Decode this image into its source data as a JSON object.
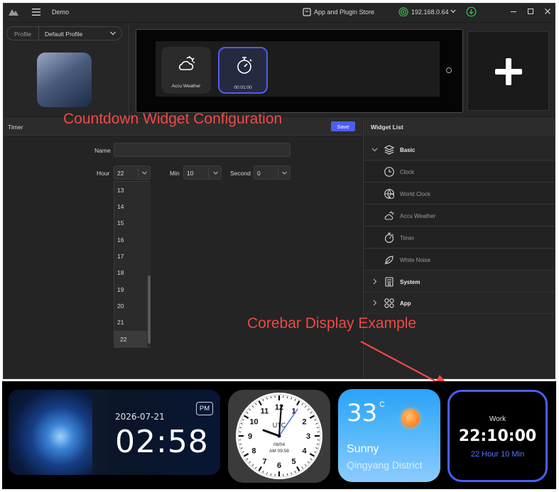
{
  "titlebar": {
    "title": "Demo",
    "store_label": "App and Plugin Store",
    "ip": "192.168.0.64"
  },
  "profile": {
    "label": "Profile",
    "selected": "Default Profile"
  },
  "preview": {
    "widgets": [
      {
        "label": "Accu Weather",
        "icon": "weather-cloud-sun-icon"
      },
      {
        "label": "00:01:00",
        "icon": "timer-icon"
      }
    ]
  },
  "config": {
    "title": "Timer",
    "save_label": "Save",
    "name_label": "Name",
    "name_value": "",
    "hour_label": "Hour",
    "hour_value": "22",
    "min_label": "Min",
    "min_value": "10",
    "second_label": "Second",
    "second_value": "0",
    "hour_options": [
      "13",
      "14",
      "15",
      "16",
      "17",
      "18",
      "19",
      "20",
      "21",
      "22"
    ],
    "hour_selected": "22"
  },
  "widget_list": {
    "title": "Widget List",
    "groups": [
      {
        "label": "Basic",
        "expanded": true,
        "icon": "layers-icon",
        "items": [
          {
            "label": "Clock",
            "icon": "clock-icon"
          },
          {
            "label": "World Clock",
            "icon": "world-clock-icon"
          },
          {
            "label": "Accu Weather",
            "icon": "weather-cloud-sun-icon"
          },
          {
            "label": "Timer",
            "icon": "timer-icon"
          },
          {
            "label": "White Noise",
            "icon": "leaf-icon"
          }
        ]
      },
      {
        "label": "System",
        "expanded": false,
        "icon": "system-icon",
        "items": []
      },
      {
        "label": "App",
        "expanded": false,
        "icon": "app-grid-icon",
        "items": []
      }
    ]
  },
  "annotations": {
    "config": "Countdown Widget Configuration",
    "corebar": "Corebar Display Example"
  },
  "corebar": {
    "date": "2026-07-21",
    "time": "02:58",
    "ampm": "PM",
    "clock_label": "UTC",
    "clock_date": "08/04",
    "clock_time": "AM 09:58",
    "clock_numbers": [
      "12",
      "1",
      "2",
      "3",
      "4",
      "5",
      "6",
      "7",
      "8",
      "9",
      "10",
      "11"
    ],
    "weather_temp": "33",
    "weather_unit": "C",
    "weather_condition": "Sunny",
    "weather_location": "Qingyang District",
    "timer_title": "Work",
    "timer_value": "22:10:00",
    "timer_sub": "22 Hour 10 Min"
  },
  "colors": {
    "accent": "#4f5df0",
    "annotation": "#f04848",
    "window_bg": "#1e1e1e"
  }
}
